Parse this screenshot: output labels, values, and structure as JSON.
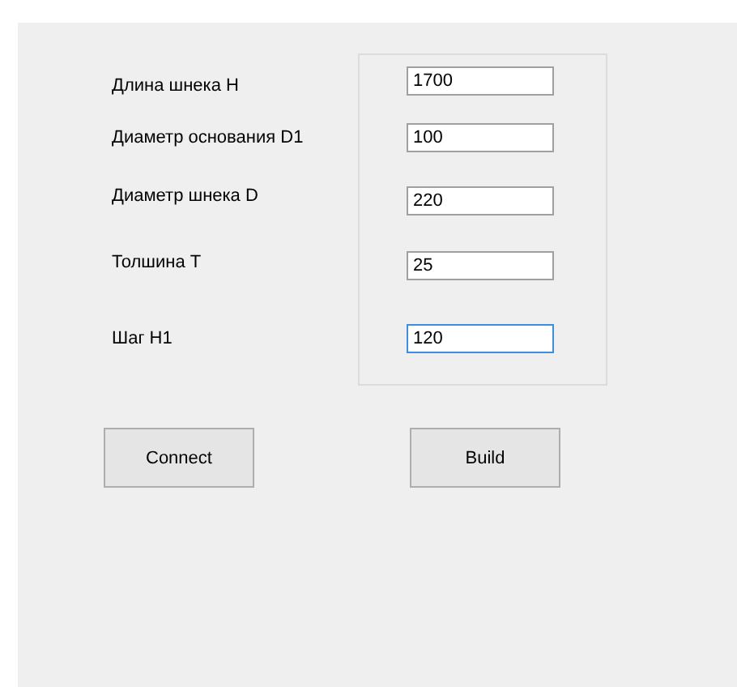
{
  "fields": [
    {
      "label": "Длина шнека H",
      "value": "1700",
      "focused": false
    },
    {
      "label": "Диаметр основания D1",
      "value": "100",
      "focused": false
    },
    {
      "label": "Диаметр шнека D",
      "value": "220",
      "focused": false
    },
    {
      "label": "Толшина T",
      "value": "25",
      "focused": false
    },
    {
      "label": "Шаг H1",
      "value": "120",
      "focused": true
    }
  ],
  "buttons": [
    "Connect",
    "Build"
  ]
}
